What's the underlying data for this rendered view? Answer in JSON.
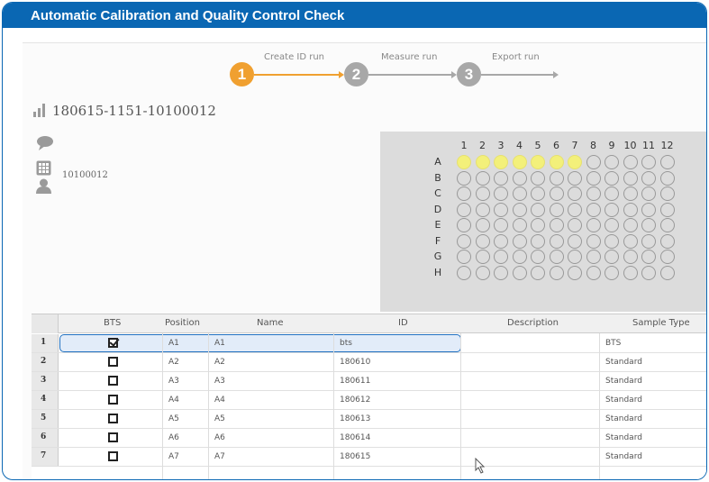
{
  "banner": {
    "title": "Automatic Calibration and Quality Control Check"
  },
  "wizard": {
    "steps": [
      {
        "number": "1",
        "label": "Create ID run",
        "active": true
      },
      {
        "number": "2",
        "label": "Measure run",
        "active": false
      },
      {
        "number": "3",
        "label": "Export run",
        "active": false
      }
    ],
    "active_color": "#f0a030",
    "inactive_color": "#a8a8a8"
  },
  "run": {
    "id": "180615-1151-10100012"
  },
  "sidebar": {
    "barcode": "10100012"
  },
  "plate": {
    "columns": [
      "1",
      "2",
      "3",
      "4",
      "5",
      "6",
      "7",
      "8",
      "9",
      "10",
      "11",
      "12"
    ],
    "rows": [
      "A",
      "B",
      "C",
      "D",
      "E",
      "F",
      "G",
      "H"
    ],
    "filled_wells": [
      "A1",
      "A2",
      "A3",
      "A4",
      "A5",
      "A6",
      "A7"
    ],
    "fill_color": "#f3f07a"
  },
  "table": {
    "headers": {
      "bts": "BTS",
      "position": "Position",
      "name": "Name",
      "id": "ID",
      "description": "Description",
      "sample_type": "Sample Type"
    },
    "rows": [
      {
        "num": "1",
        "checked": true,
        "position": "A1",
        "name": "A1",
        "id": "bts",
        "description": "",
        "sample_type": "BTS"
      },
      {
        "num": "2",
        "checked": false,
        "position": "A2",
        "name": "A2",
        "id": "180610",
        "description": "",
        "sample_type": "Standard"
      },
      {
        "num": "3",
        "checked": false,
        "position": "A3",
        "name": "A3",
        "id": "180611",
        "description": "",
        "sample_type": "Standard"
      },
      {
        "num": "4",
        "checked": false,
        "position": "A4",
        "name": "A4",
        "id": "180612",
        "description": "",
        "sample_type": "Standard"
      },
      {
        "num": "5",
        "checked": false,
        "position": "A5",
        "name": "A5",
        "id": "180613",
        "description": "",
        "sample_type": "Standard"
      },
      {
        "num": "6",
        "checked": false,
        "position": "A6",
        "name": "A6",
        "id": "180614",
        "description": "",
        "sample_type": "Standard"
      },
      {
        "num": "7",
        "checked": false,
        "position": "A7",
        "name": "A7",
        "id": "180615",
        "description": "",
        "sample_type": "Standard"
      }
    ]
  }
}
